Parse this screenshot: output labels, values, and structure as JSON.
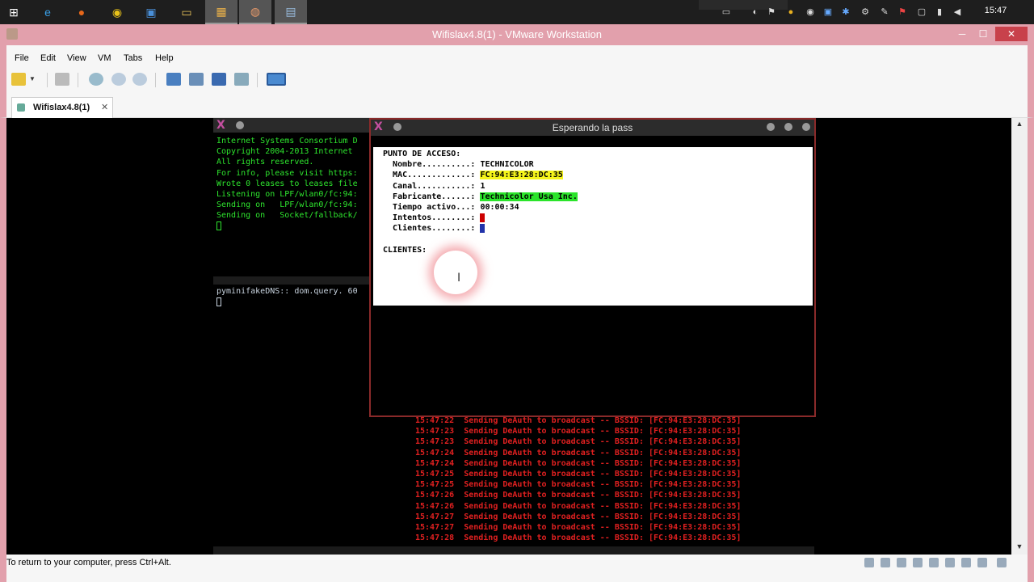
{
  "taskbar": {
    "icons": [
      "windows-start-icon",
      "ie-icon",
      "firefox-icon",
      "chrome-icon",
      "app-icon",
      "explorer-icon",
      "vmware-icon",
      "app2-icon",
      "notepad-icon"
    ],
    "clock": "15:47"
  },
  "window": {
    "title": "Wifislax4.8(1) - VMware Workstation",
    "minimize": "─",
    "maximize": "☐",
    "close": "✕"
  },
  "menu": {
    "items": [
      "File",
      "Edit",
      "View",
      "VM",
      "Tabs",
      "Help"
    ]
  },
  "tab": {
    "label": "Wifislax4.8(1)",
    "close": "✕"
  },
  "status": {
    "message": "To return to your computer, press Ctrl+Alt."
  },
  "terminal_left": {
    "lines": [
      "Internet Systems Consortium D",
      "Copyright 2004-2013 Internet",
      "All rights reserved.",
      "For info, please visit https:",
      "Wrote 0 leases to leases file",
      "Listening on LPF/wlan0/fc:94:",
      "Sending on   LPF/wlan0/fc:94:",
      "Sending on   Socket/fallback/"
    ]
  },
  "terminal_mid": {
    "line": "pyminifakeDNS:: dom.query. 60"
  },
  "front": {
    "title": "Esperando la pass",
    "header": "PUNTO DE ACCESO:",
    "nombre_label": "Nombre..........:",
    "nombre": "TECHNICOLOR",
    "mac_label": "MAC.............:",
    "mac": "FC:94:E3:28:DC:35",
    "canal_label": "Canal...........:",
    "canal": "1",
    "fabricante_label": "Fabricante......:",
    "fabricante": "Technicolor Usa Inc.",
    "tiempo_label": "Tiempo activo...:",
    "tiempo": "00:00:34",
    "intentos_label": "Intentos........:",
    "clientes_label": "Clientes........:",
    "clientes_header": "CLIENTES:"
  },
  "deauth": {
    "lines": [
      "15:47:22  Sending DeAuth to broadcast -- BSSID: [FC:94:E3:28:DC:35]",
      "15:47:23  Sending DeAuth to broadcast -- BSSID: [FC:94:E3:28:DC:35]",
      "15:47:23  Sending DeAuth to broadcast -- BSSID: [FC:94:E3:28:DC:35]",
      "15:47:24  Sending DeAuth to broadcast -- BSSID: [FC:94:E3:28:DC:35]",
      "15:47:24  Sending DeAuth to broadcast -- BSSID: [FC:94:E3:28:DC:35]",
      "15:47:25  Sending DeAuth to broadcast -- BSSID: [FC:94:E3:28:DC:35]",
      "15:47:25  Sending DeAuth to broadcast -- BSSID: [FC:94:E3:28:DC:35]",
      "15:47:26  Sending DeAuth to broadcast -- BSSID: [FC:94:E3:28:DC:35]",
      "15:47:26  Sending DeAuth to broadcast -- BSSID: [FC:94:E3:28:DC:35]",
      "15:47:27  Sending DeAuth to broadcast -- BSSID: [FC:94:E3:28:DC:35]",
      "15:47:27  Sending DeAuth to broadcast -- BSSID: [FC:94:E3:28:DC:35]",
      "15:47:28  Sending DeAuth to broadcast -- BSSID: [FC:94:E3:28:DC:35]"
    ]
  },
  "colors": {
    "vmware_frame": "#e2a0ac",
    "terminal_green": "#2ee52e",
    "deauth_red": "#e02020",
    "mac_highlight": "#f5f51a",
    "vendor_highlight": "#2be42b"
  }
}
